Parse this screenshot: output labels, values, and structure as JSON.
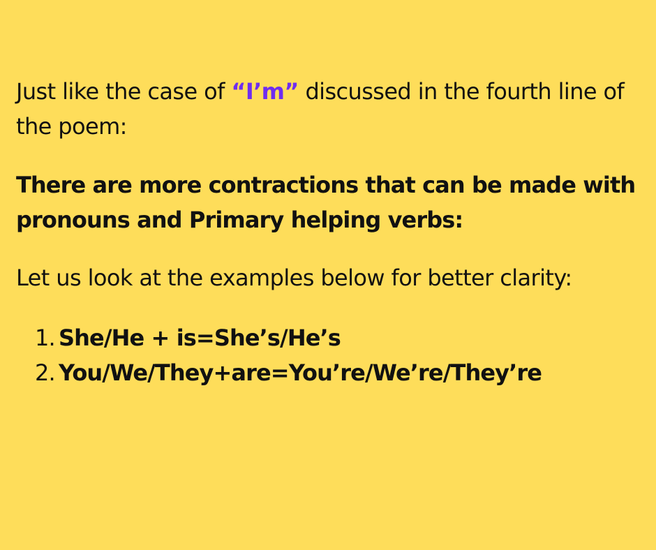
{
  "intro": {
    "before": "Just like the case of ",
    "highlight": "“I’m”",
    "after": " discussed in the fourth line of the poem:"
  },
  "statement": "There are more contractions that can be made with pronouns and Primary helping verbs:",
  "lead_in": "Let us look at the examples below for better clarity:",
  "examples": [
    {
      "number": "1.",
      "text": "She/He + is=She’s/He’s"
    },
    {
      "number": "2.",
      "text": "You/We/They+are=You’re/We’re/They’re"
    }
  ],
  "colors": {
    "background": "#fedd5a",
    "text": "#111111",
    "highlight": "#6f2df0"
  }
}
